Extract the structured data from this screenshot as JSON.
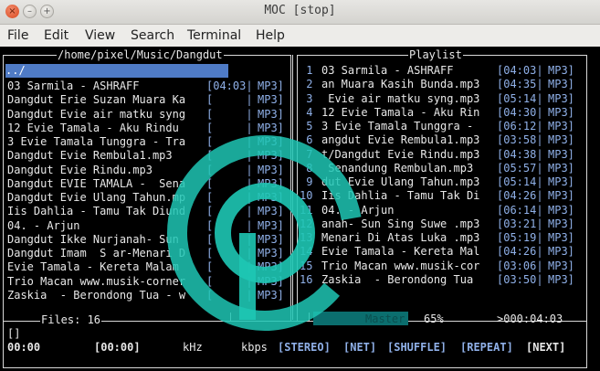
{
  "window": {
    "title": "MOC [stop]",
    "close_glyph": "×",
    "min_glyph": "–",
    "max_glyph": "+"
  },
  "menu": [
    "File",
    "Edit",
    "View",
    "Search",
    "Terminal",
    "Help"
  ],
  "left_panel": {
    "path": "/home/pixel/Music/Dangdut",
    "parent": "../",
    "items": [
      {
        "name": "03 Sarmila - ASHRAFF",
        "time": "[04:03|",
        "fmt": "MP3]"
      },
      {
        "name": "Dangdut Erie Suzan Muara Ka",
        "time": "[     |",
        "fmt": "MP3]"
      },
      {
        "name": "Dangdut Evie air matku syng",
        "time": "[     |",
        "fmt": "MP3]"
      },
      {
        "name": "12 Evie Tamala - Aku Rindu ",
        "time": "[     |",
        "fmt": "MP3]"
      },
      {
        "name": "3 Evie Tamala Tunggra - Tra",
        "time": "[     |",
        "fmt": "MP3]"
      },
      {
        "name": "Dangdut Evie Rembula1.mp3  ",
        "time": "[     |",
        "fmt": "MP3]"
      },
      {
        "name": "Dangdut Evie Rindu.mp3     ",
        "time": "[     |",
        "fmt": "MP3]"
      },
      {
        "name": "Dangdut EVIE TAMALA -  Sena",
        "time": "[     |",
        "fmt": "MP3]"
      },
      {
        "name": "Dangdut Evie Ulang Tahun.mp",
        "time": "[     |",
        "fmt": "MP3]"
      },
      {
        "name": "Iis Dahlia - Tamu Tak Diund",
        "time": "[     |",
        "fmt": "MP3]"
      },
      {
        "name": "04. - Arjun                ",
        "time": "[     |",
        "fmt": "MP3]"
      },
      {
        "name": "Dangdut Ikke Nurjanah- Sun ",
        "time": "[     |",
        "fmt": "MP3]"
      },
      {
        "name": "Dangdut Imam  S ar-Menari D",
        "time": "[     |",
        "fmt": "MP3]"
      },
      {
        "name": "Evie Tamala - Kereta Malam ",
        "time": "[     |",
        "fmt": "MP3]"
      },
      {
        "name": "Trio Macan www.musik-corner",
        "time": "[     |",
        "fmt": "MP3]"
      },
      {
        "name": "Zaskia  - Berondong Tua - w",
        "time": "[     |",
        "fmt": "MP3]"
      }
    ],
    "files_label": "Files: 16"
  },
  "playlist": {
    "header": "Playlist",
    "items": [
      {
        "num": " 1",
        "name": "03 Sarmila - ASHRAFF    ",
        "time": "[04:03|",
        "fmt": "MP3]"
      },
      {
        "num": " 2",
        "name": "an Muara Kasih Bunda.mp3",
        "time": "[04:35|",
        "fmt": "MP3]"
      },
      {
        "num": " 3",
        "name": " Evie air matku syng.mp3",
        "time": "[05:14|",
        "fmt": "MP3]"
      },
      {
        "num": " 4",
        "name": "12 Evie Tamala - Aku Rin",
        "time": "[04:30|",
        "fmt": "MP3]"
      },
      {
        "num": " 5",
        "name": "3 Evie Tamala Tunggra - ",
        "time": "[06:12|",
        "fmt": "MP3]"
      },
      {
        "num": " 6",
        "name": "angdut Evie Rembula1.mp3",
        "time": "[03:58|",
        "fmt": "MP3]"
      },
      {
        "num": " 7",
        "name": "t/Dangdut Evie Rindu.mp3",
        "time": "[04:38|",
        "fmt": "MP3]"
      },
      {
        "num": " 8",
        "name": " Senandung Rembulan.mp3",
        "time": "[05:57|",
        "fmt": "MP3]"
      },
      {
        "num": " 9",
        "name": "dut Evie Ulang Tahun.mp3",
        "time": "[05:14|",
        "fmt": "MP3]"
      },
      {
        "num": "10",
        "name": "Iis Dahlia - Tamu Tak Di",
        "time": "[04:26|",
        "fmt": "MP3]"
      },
      {
        "num": "11",
        "name": "04. - Arjun             ",
        "time": "[06:14|",
        "fmt": "MP3]"
      },
      {
        "num": "12",
        "name": "anah- Sun Sing Suwe .mp3",
        "time": "[03:21|",
        "fmt": "MP3]"
      },
      {
        "num": "13",
        "name": "Menari Di Atas Luka .mp3",
        "time": "[05:19|",
        "fmt": "MP3]"
      },
      {
        "num": "14",
        "name": "Evie Tamala - Kereta Mal",
        "time": "[04:26|",
        "fmt": "MP3]"
      },
      {
        "num": "15",
        "name": "Trio Macan www.musik-cor",
        "time": "[03:06|",
        "fmt": "MP3]"
      },
      {
        "num": "16",
        "name": "Zaskia  - Berondong Tua ",
        "time": "[03:50|",
        "fmt": "MP3]"
      }
    ]
  },
  "status": {
    "master_label": "Master",
    "volume_label": "65%",
    "volume": 0.65,
    "total_time": ">000:04:03",
    "title_line": "[]",
    "cur_time": "00:00",
    "total_field": "[00:00]",
    "khz": "kHz",
    "kbps": "kbps",
    "flags": [
      "[STEREO]",
      "[NET]",
      "[SHUFFLE]",
      "[REPEAT]",
      "[NEXT]"
    ]
  },
  "colors": {
    "selection": "#4f7bc6",
    "accent_blue": "#8fb0e8",
    "master_bar": "#0b6e6e"
  }
}
